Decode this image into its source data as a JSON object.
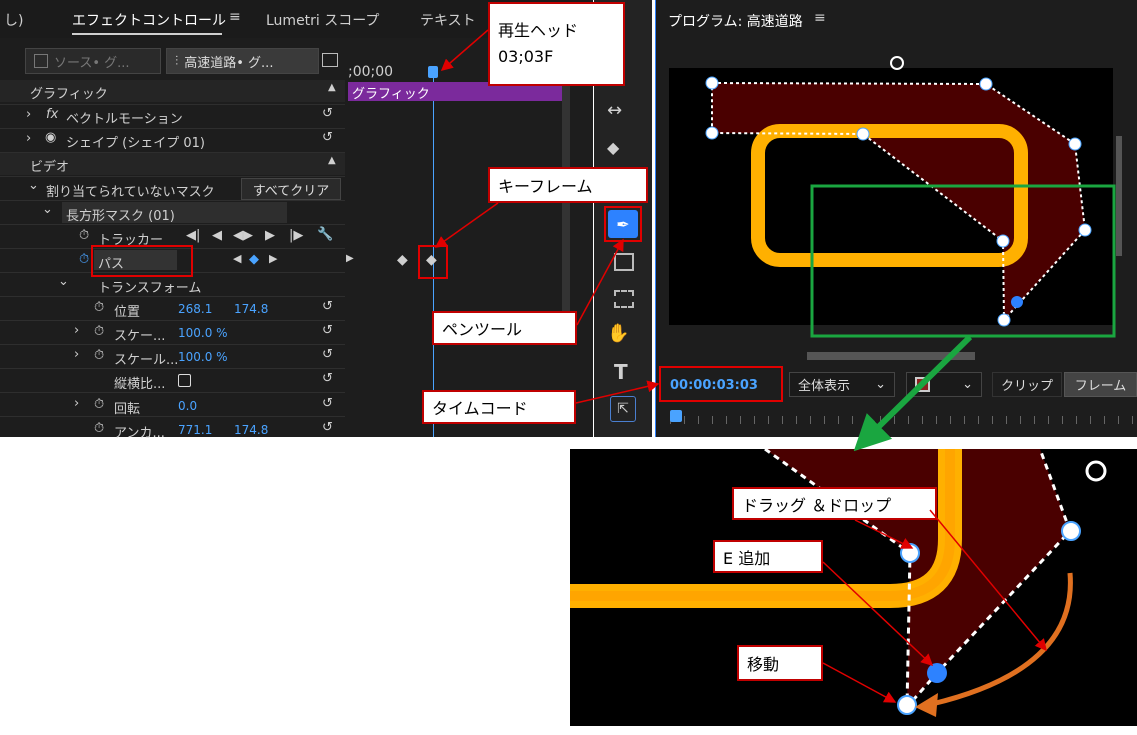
{
  "tabs": {
    "partial": "し)",
    "effect_controls": "エフェクトコントロール",
    "menu": "≡",
    "lumetri": "Lumetri スコープ",
    "text": "テキスト"
  },
  "source_row": {
    "source": "ソース• グ...",
    "sequence": "高速道路• グ..."
  },
  "timeline": {
    "timecode": ";00;00",
    "clip_label": "グラフィック"
  },
  "rows": {
    "graphics_header": "グラフィック",
    "vector_motion": "ベクトルモーション",
    "shape": "シェイプ (シェイプ 01)",
    "video_header": "ビデオ",
    "unassigned_mask": "割り当てられていないマスク",
    "clear_all": "すべてクリア",
    "rect_mask": "長方形マスク (01)",
    "tracker": "トラッカー",
    "path": "パス",
    "transform": "トランスフォーム",
    "position": "位置",
    "position_x": "268.1",
    "position_y": "174.8",
    "scale1": "スケー...",
    "scale1_val": "100.0 %",
    "scale2": "スケール...",
    "scale2_val": "100.0 %",
    "uniform": "縦横比...",
    "rotation": "回転",
    "rotation_val": "0.0",
    "anchor": "アンカ...",
    "anchor_x": "771.1",
    "anchor_y": "174.8"
  },
  "program": {
    "title": "プログラム: 高速道路",
    "menu": "≡",
    "timecode": "00:00:03:03",
    "zoom": "全体表示",
    "clip_label": "クリップ",
    "frame_label": "フレーム"
  },
  "callouts": {
    "playhead": "再生ヘッド\n03;03F",
    "keyframe": "キーフレーム",
    "pen_tool": "ペンツール",
    "timecode": "タイムコード",
    "drag_drop": "ドラッグ ＆ドロップ",
    "e_add": "E 追加",
    "move": "移動"
  },
  "colors": {
    "accent_blue": "#4aa3ff",
    "clip_purple": "#7b2a9c",
    "mask_fill": "#4a0000",
    "road_orange": "#ffb000",
    "callout_red": "#c00000",
    "green_box": "#1aa640",
    "arrow_orange": "#e07020"
  }
}
